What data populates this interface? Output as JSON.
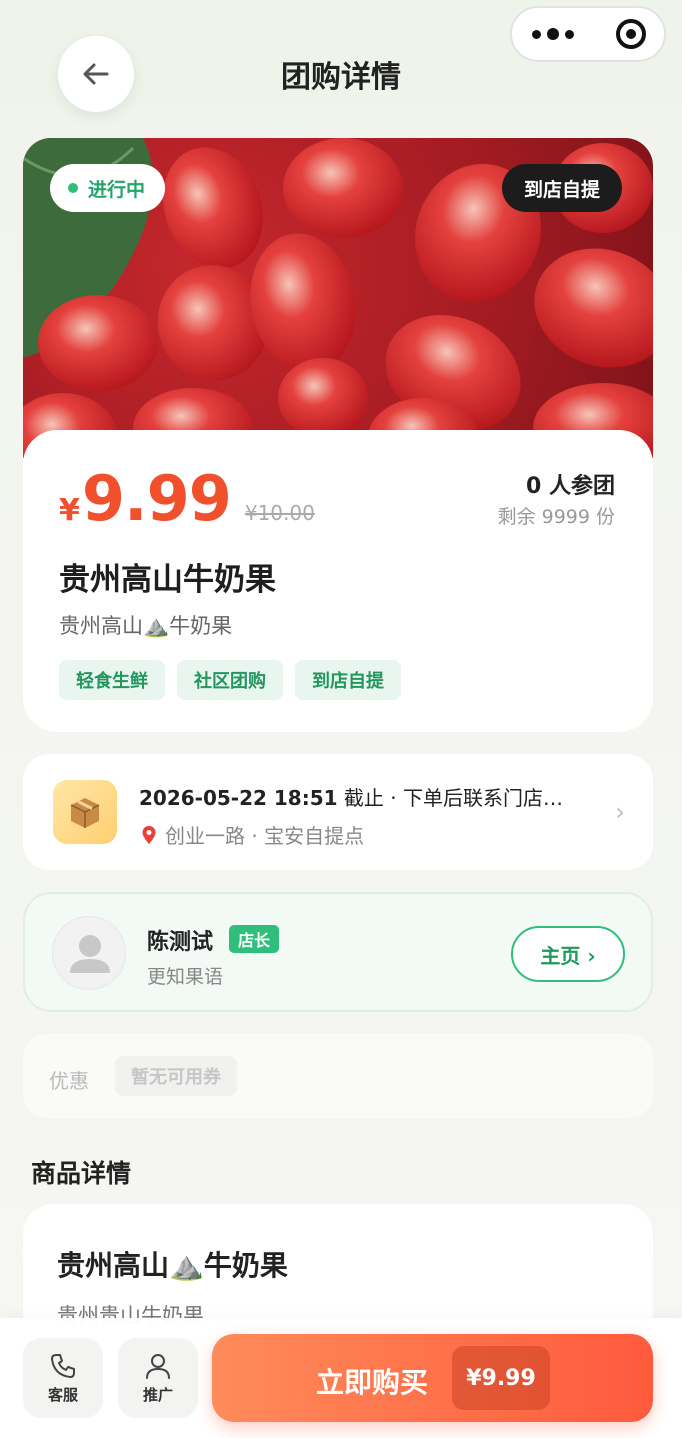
{
  "header": {
    "title": "团购详情"
  },
  "hero": {
    "status": "进行中",
    "pickup": "到店自提"
  },
  "product": {
    "currency": "¥",
    "price": "9.99",
    "original_price": "¥10.00",
    "join_count": "0 人参团",
    "remaining": "剩余 9999 份",
    "name": "贵州高山牛奶果",
    "subtitle": "贵州高山⛰️牛奶果",
    "tags": [
      "轻食生鲜",
      "社区团购",
      "到店自提"
    ]
  },
  "deadline": {
    "datetime": "2026-05-22 18:51",
    "suffix": " 截止 · 下单后联系门店…",
    "location": "创业一路 · 宝安自提点"
  },
  "leader": {
    "name": "陈测试",
    "badge": "店长",
    "shop": "更知果语",
    "home_label": "主页 ›"
  },
  "coupon": {
    "label": "优惠",
    "status": "暂无可用券"
  },
  "detail": {
    "section_title": "商品详情",
    "title": "贵州高山⛰️牛奶果",
    "text": "贵州贵山牛奶果"
  },
  "bottom": {
    "service_label": "客服",
    "promote_label": "推广",
    "buy_label": "立即购买",
    "buy_price": "¥9.99"
  },
  "colors": {
    "accent_green": "#2fbf7a",
    "price_red": "#f0502c",
    "buy_orange": "#ff6a45"
  }
}
